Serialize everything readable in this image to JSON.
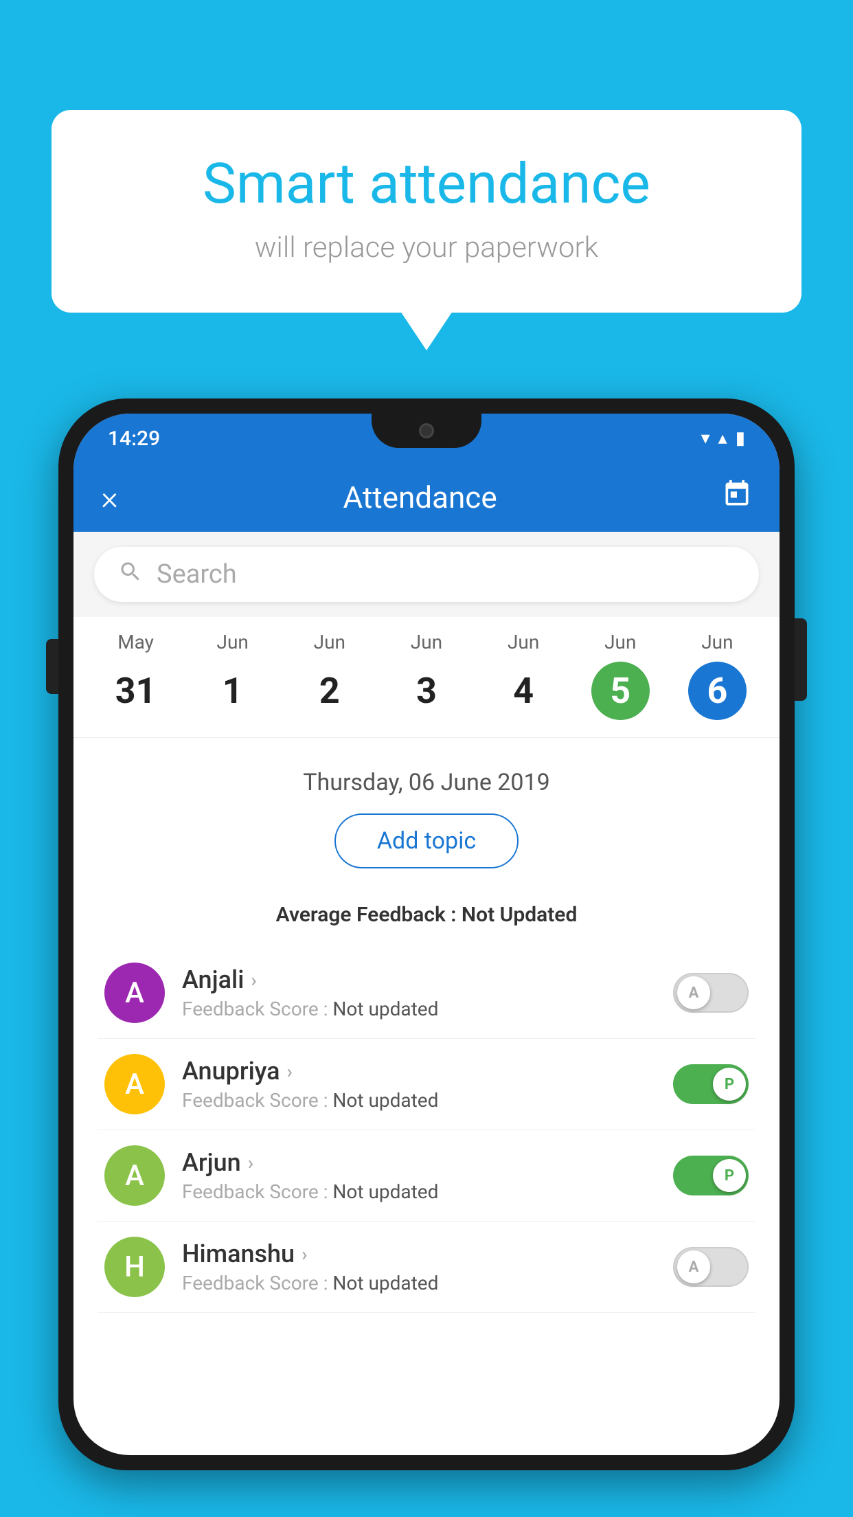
{
  "background_color": "#1ab8e8",
  "bubble": {
    "title": "Smart attendance",
    "subtitle": "will replace your paperwork"
  },
  "phone": {
    "status_bar": {
      "time": "14:29",
      "wifi": "▼",
      "signal": "▲",
      "battery": "▮"
    },
    "header": {
      "close_label": "×",
      "title": "Attendance",
      "calendar_icon": "📅"
    },
    "search": {
      "placeholder": "Search"
    },
    "calendar": {
      "days": [
        {
          "month": "May",
          "num": "31",
          "state": "normal"
        },
        {
          "month": "Jun",
          "num": "1",
          "state": "normal"
        },
        {
          "month": "Jun",
          "num": "2",
          "state": "normal"
        },
        {
          "month": "Jun",
          "num": "3",
          "state": "normal"
        },
        {
          "month": "Jun",
          "num": "4",
          "state": "normal"
        },
        {
          "month": "Jun",
          "num": "5",
          "state": "today"
        },
        {
          "month": "Jun",
          "num": "6",
          "state": "selected"
        }
      ]
    },
    "selected_date": "Thursday, 06 June 2019",
    "add_topic_label": "Add topic",
    "avg_feedback_label": "Average Feedback :",
    "avg_feedback_value": "Not Updated",
    "students": [
      {
        "name": "Anjali",
        "avatar_letter": "A",
        "avatar_color": "#9c27b0",
        "feedback_label": "Feedback Score :",
        "feedback_value": "Not updated",
        "toggle_state": "off",
        "toggle_label": "A"
      },
      {
        "name": "Anupriya",
        "avatar_letter": "A",
        "avatar_color": "#ffc107",
        "feedback_label": "Feedback Score :",
        "feedback_value": "Not updated",
        "toggle_state": "on",
        "toggle_label": "P"
      },
      {
        "name": "Arjun",
        "avatar_letter": "A",
        "avatar_color": "#8bc34a",
        "feedback_label": "Feedback Score :",
        "feedback_value": "Not updated",
        "toggle_state": "on",
        "toggle_label": "P"
      },
      {
        "name": "Himanshu",
        "avatar_letter": "H",
        "avatar_color": "#8bc34a",
        "feedback_label": "Feedback Score :",
        "feedback_value": "Not updated",
        "toggle_state": "off",
        "toggle_label": "A"
      }
    ]
  }
}
